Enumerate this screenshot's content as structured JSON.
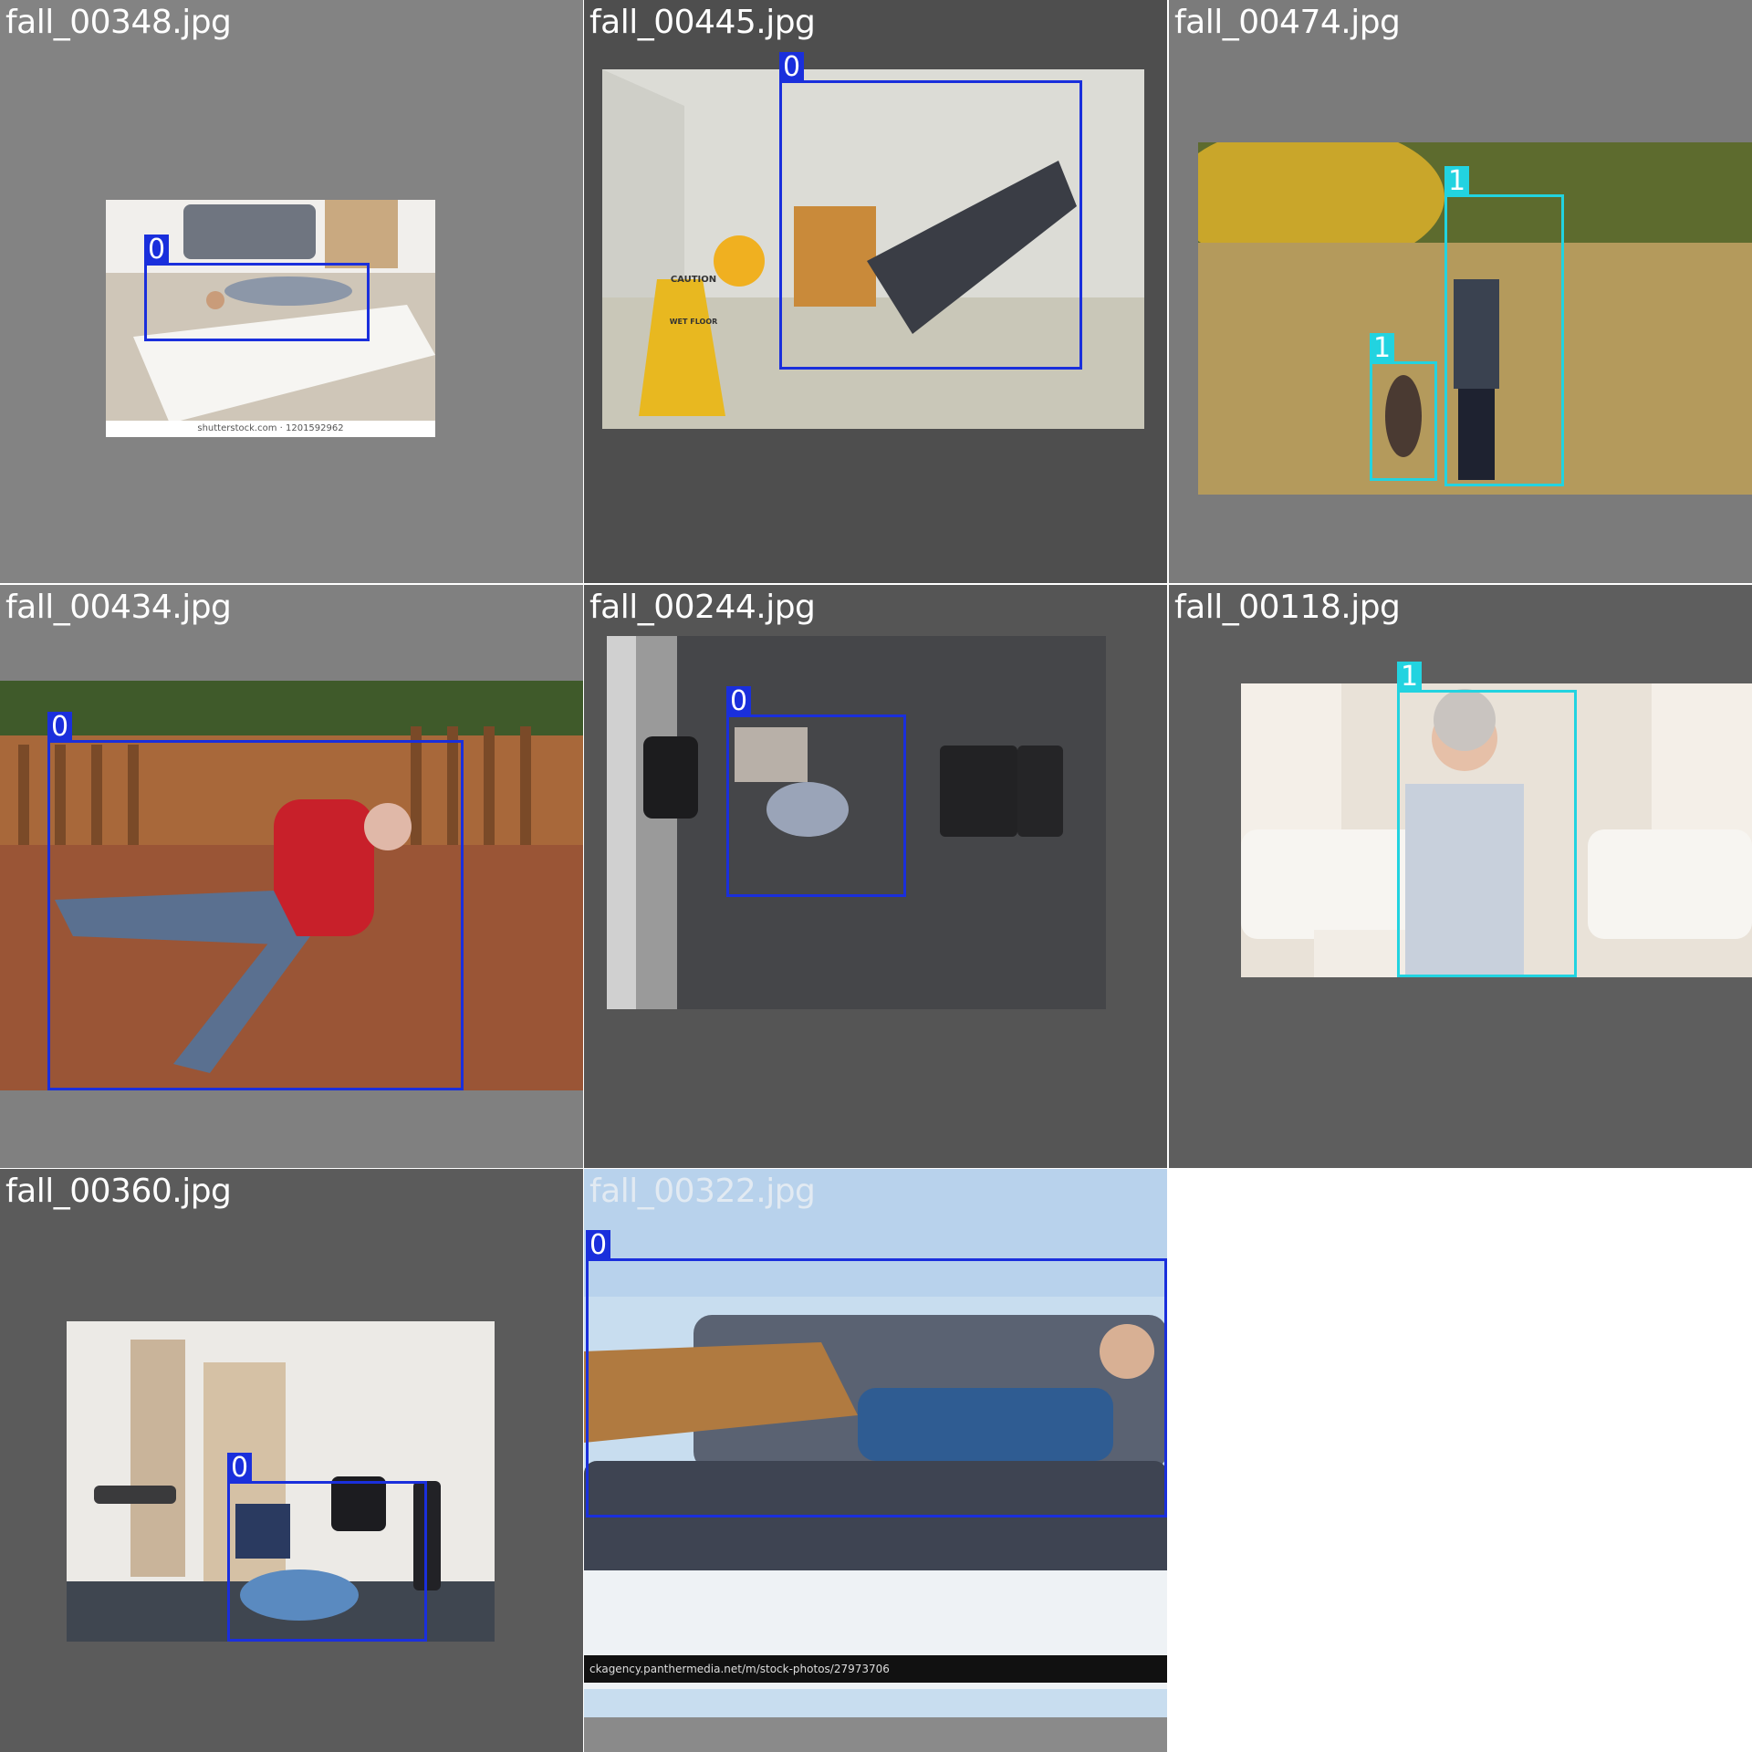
{
  "mosaic": {
    "colors": {
      "class_0": "#1a2fdc",
      "class_1": "#22d3e0"
    },
    "tiles": [
      {
        "filename": "fall_00348.jpg",
        "photo_caption": "shutterstock.com · 1201592962",
        "detections": [
          {
            "class_label": "0"
          }
        ]
      },
      {
        "filename": "fall_00445.jpg",
        "sign_text": "CAUTION",
        "sign_subtext": "WET FLOOR",
        "detections": [
          {
            "class_label": "0"
          }
        ]
      },
      {
        "filename": "fall_00474.jpg",
        "detections": [
          {
            "class_label": "1"
          },
          {
            "class_label": "1"
          }
        ]
      },
      {
        "filename": "fall_00434.jpg",
        "detections": [
          {
            "class_label": "0"
          }
        ]
      },
      {
        "filename": "fall_00244.jpg",
        "detections": [
          {
            "class_label": "0"
          }
        ]
      },
      {
        "filename": "fall_00118.jpg",
        "detections": [
          {
            "class_label": "1"
          }
        ]
      },
      {
        "filename": "fall_00360.jpg",
        "detections": [
          {
            "class_label": "0"
          }
        ]
      },
      {
        "filename": "fall_00322.jpg",
        "photo_caption": "ckagency.panthermedia.net/m/stock-photos/27973706",
        "detections": [
          {
            "class_label": "0"
          }
        ]
      }
    ]
  }
}
